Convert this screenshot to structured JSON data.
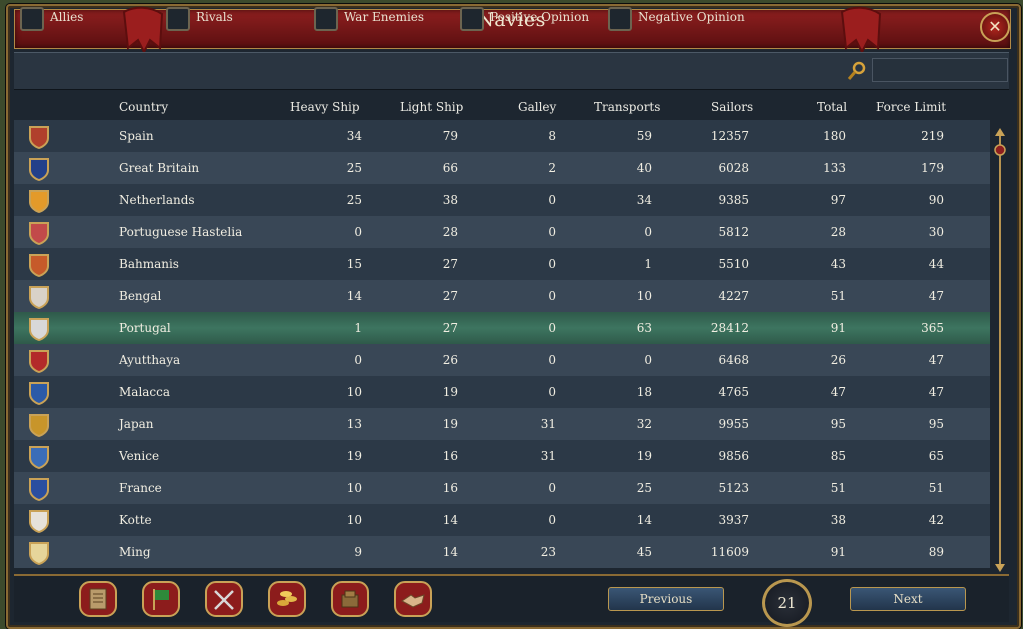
{
  "window": {
    "title": "Navies",
    "close_icon": "close-icon"
  },
  "filters": [
    {
      "label": "Allies"
    },
    {
      "label": "Rivals"
    },
    {
      "label": "War Enemies"
    },
    {
      "label": "Positive Opinion"
    },
    {
      "label": "Negative Opinion"
    }
  ],
  "search": {
    "icon": "magnifier-icon",
    "value": ""
  },
  "columns": {
    "country": "Country",
    "heavy": "Heavy Ship",
    "light": "Light Ship",
    "galley": "Galley",
    "transports": "Transports",
    "sailors": "Sailors",
    "total": "Total",
    "force_limit": "Force Limit"
  },
  "rows": [
    {
      "country": "Spain",
      "heavy": "34",
      "light": "79",
      "galley": "8",
      "transports": "59",
      "sailors": "12357",
      "total": "180",
      "force_limit": "219",
      "flag": "#b0402c"
    },
    {
      "country": "Great Britain",
      "heavy": "25",
      "light": "66",
      "galley": "2",
      "transports": "40",
      "sailors": "6028",
      "total": "133",
      "force_limit": "179",
      "flag": "#23408a"
    },
    {
      "country": "Netherlands",
      "heavy": "25",
      "light": "38",
      "galley": "0",
      "transports": "34",
      "sailors": "9385",
      "total": "97",
      "force_limit": "90",
      "flag": "#e39a2a"
    },
    {
      "country": "Portuguese Hastelia",
      "heavy": "0",
      "light": "28",
      "galley": "0",
      "transports": "0",
      "sailors": "5812",
      "total": "28",
      "force_limit": "30",
      "flag": "#c24a4a"
    },
    {
      "country": "Bahmanis",
      "heavy": "15",
      "light": "27",
      "galley": "0",
      "transports": "1",
      "sailors": "5510",
      "total": "43",
      "force_limit": "44",
      "flag": "#c65a2a"
    },
    {
      "country": "Bengal",
      "heavy": "14",
      "light": "27",
      "galley": "0",
      "transports": "10",
      "sailors": "4227",
      "total": "51",
      "force_limit": "47",
      "flag": "#d9d2c8"
    },
    {
      "country": "Portugal",
      "heavy": "1",
      "light": "27",
      "galley": "0",
      "transports": "63",
      "sailors": "28412",
      "total": "91",
      "force_limit": "365",
      "flag": "#d8d8d8"
    },
    {
      "country": "Ayutthaya",
      "heavy": "0",
      "light": "26",
      "galley": "0",
      "transports": "0",
      "sailors": "6468",
      "total": "26",
      "force_limit": "47",
      "flag": "#b32a2a"
    },
    {
      "country": "Malacca",
      "heavy": "10",
      "light": "19",
      "galley": "0",
      "transports": "18",
      "sailors": "4765",
      "total": "47",
      "force_limit": "47",
      "flag": "#2b5aa8"
    },
    {
      "country": "Japan",
      "heavy": "13",
      "light": "19",
      "galley": "31",
      "transports": "32",
      "sailors": "9955",
      "total": "95",
      "force_limit": "95",
      "flag": "#c8952a"
    },
    {
      "country": "Venice",
      "heavy": "19",
      "light": "16",
      "galley": "31",
      "transports": "19",
      "sailors": "9856",
      "total": "85",
      "force_limit": "65",
      "flag": "#3b6db8"
    },
    {
      "country": "France",
      "heavy": "10",
      "light": "16",
      "galley": "0",
      "transports": "25",
      "sailors": "5123",
      "total": "51",
      "force_limit": "51",
      "flag": "#2a4ea0"
    },
    {
      "country": "Kotte",
      "heavy": "10",
      "light": "14",
      "galley": "0",
      "transports": "14",
      "sailors": "3937",
      "total": "38",
      "force_limit": "42",
      "flag": "#e6e2da"
    },
    {
      "country": "Ming",
      "heavy": "9",
      "light": "14",
      "galley": "23",
      "transports": "45",
      "sailors": "11609",
      "total": "91",
      "force_limit": "89",
      "flag": "#e6d59a"
    }
  ],
  "selected_row": "Portugal",
  "bottom_icons": [
    {
      "name": "ledger-icon"
    },
    {
      "name": "flag-icon"
    },
    {
      "name": "crossed-swords-icon"
    },
    {
      "name": "coins-icon"
    },
    {
      "name": "trade-goods-icon"
    },
    {
      "name": "handshake-icon"
    }
  ],
  "pagination": {
    "previous": "Previous",
    "next": "Next",
    "page": "21"
  }
}
